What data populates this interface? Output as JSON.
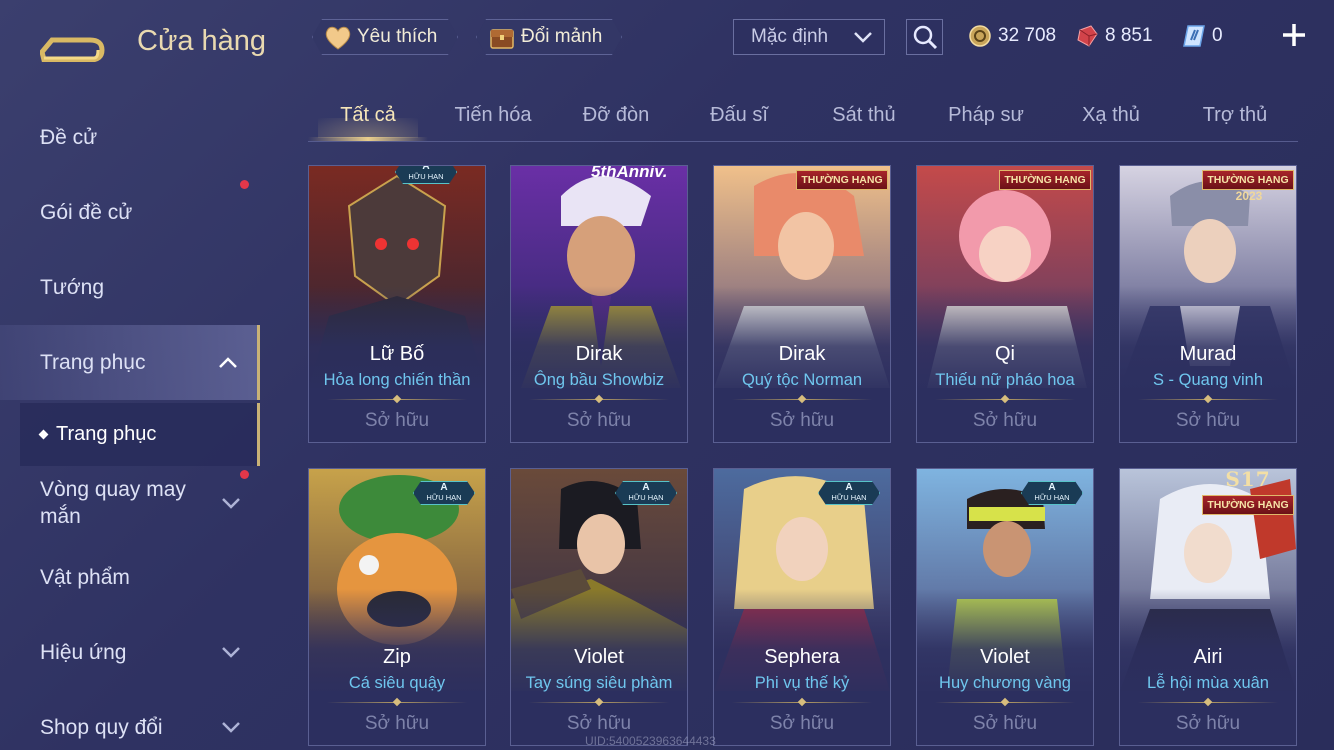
{
  "header": {
    "title": "Cửa hàng",
    "favorite_label": "Yêu thích",
    "exchange_label": "Đổi mảnh",
    "sort_value": "Mặc định",
    "currencies": [
      {
        "icon": "gold-coin-icon",
        "value": "32 708"
      },
      {
        "icon": "red-gem-icon",
        "value": "8 851"
      },
      {
        "icon": "voucher-icon",
        "value": "0"
      }
    ]
  },
  "sidebar": {
    "items": [
      {
        "label": "Đề cử"
      },
      {
        "label": "Gói đề cử",
        "notify": true
      },
      {
        "label": "Tướng"
      },
      {
        "label": "Trang phục",
        "expanded": true,
        "active": true
      },
      {
        "label": "Trang phục",
        "sub": true
      },
      {
        "label": "Vòng quay may mắn",
        "notify": true,
        "collapsed": true
      },
      {
        "label": "Vật phẩm"
      },
      {
        "label": "Hiệu ứng",
        "collapsed": true
      },
      {
        "label": "Shop quy đổi",
        "collapsed": true
      }
    ]
  },
  "tabs": [
    "Tất cả",
    "Tiến hóa",
    "Đỡ đòn",
    "Đấu sĩ",
    "Sát thủ",
    "Pháp sư",
    "Xạ thủ",
    "Trợ thủ"
  ],
  "active_tab": 0,
  "badges": {
    "rank_label": "THƯỜNG HẠNG",
    "grade_a": "A",
    "limited": "HỮU HẠN",
    "anniv": "5thAnniv.",
    "year_2023": "2023",
    "season_s17": "S17"
  },
  "cards": [
    {
      "hero": "Lữ Bố",
      "skin": "Hỏa long chiến thần",
      "owned": "Sở hữu",
      "accent": "#8a2b2b"
    },
    {
      "hero": "Dirak",
      "skin": "Ông bầu Showbiz",
      "owned": "Sở hữu",
      "accent": "#6a2fa6"
    },
    {
      "hero": "Dirak",
      "skin": "Quý tộc Norman",
      "owned": "Sở hữu",
      "accent": "#d78a6a"
    },
    {
      "hero": "Qi",
      "skin": "Thiếu nữ pháo hoa",
      "owned": "Sở hữu",
      "accent": "#e77b8f"
    },
    {
      "hero": "Murad",
      "skin": "S - Quang vinh",
      "owned": "Sở hữu",
      "accent": "#5b6aa8"
    },
    {
      "hero": "Zip",
      "skin": "Cá siêu quậy",
      "owned": "Sở hữu",
      "accent": "#d08a3a"
    },
    {
      "hero": "Violet",
      "skin": "Tay súng siêu phàm",
      "owned": "Sở hữu",
      "accent": "#5a3e2b"
    },
    {
      "hero": "Sephera",
      "skin": "Phi vụ thế kỷ",
      "owned": "Sở hữu",
      "accent": "#9f3a55"
    },
    {
      "hero": "Violet",
      "skin": "Huy chương vàng",
      "owned": "Sở hữu",
      "accent": "#5b8fc4"
    },
    {
      "hero": "Airi",
      "skin": "Lễ hội mùa xuân",
      "owned": "Sở hữu",
      "accent": "#8ea3c8"
    }
  ],
  "watermark": "UID:5400523963644433"
}
